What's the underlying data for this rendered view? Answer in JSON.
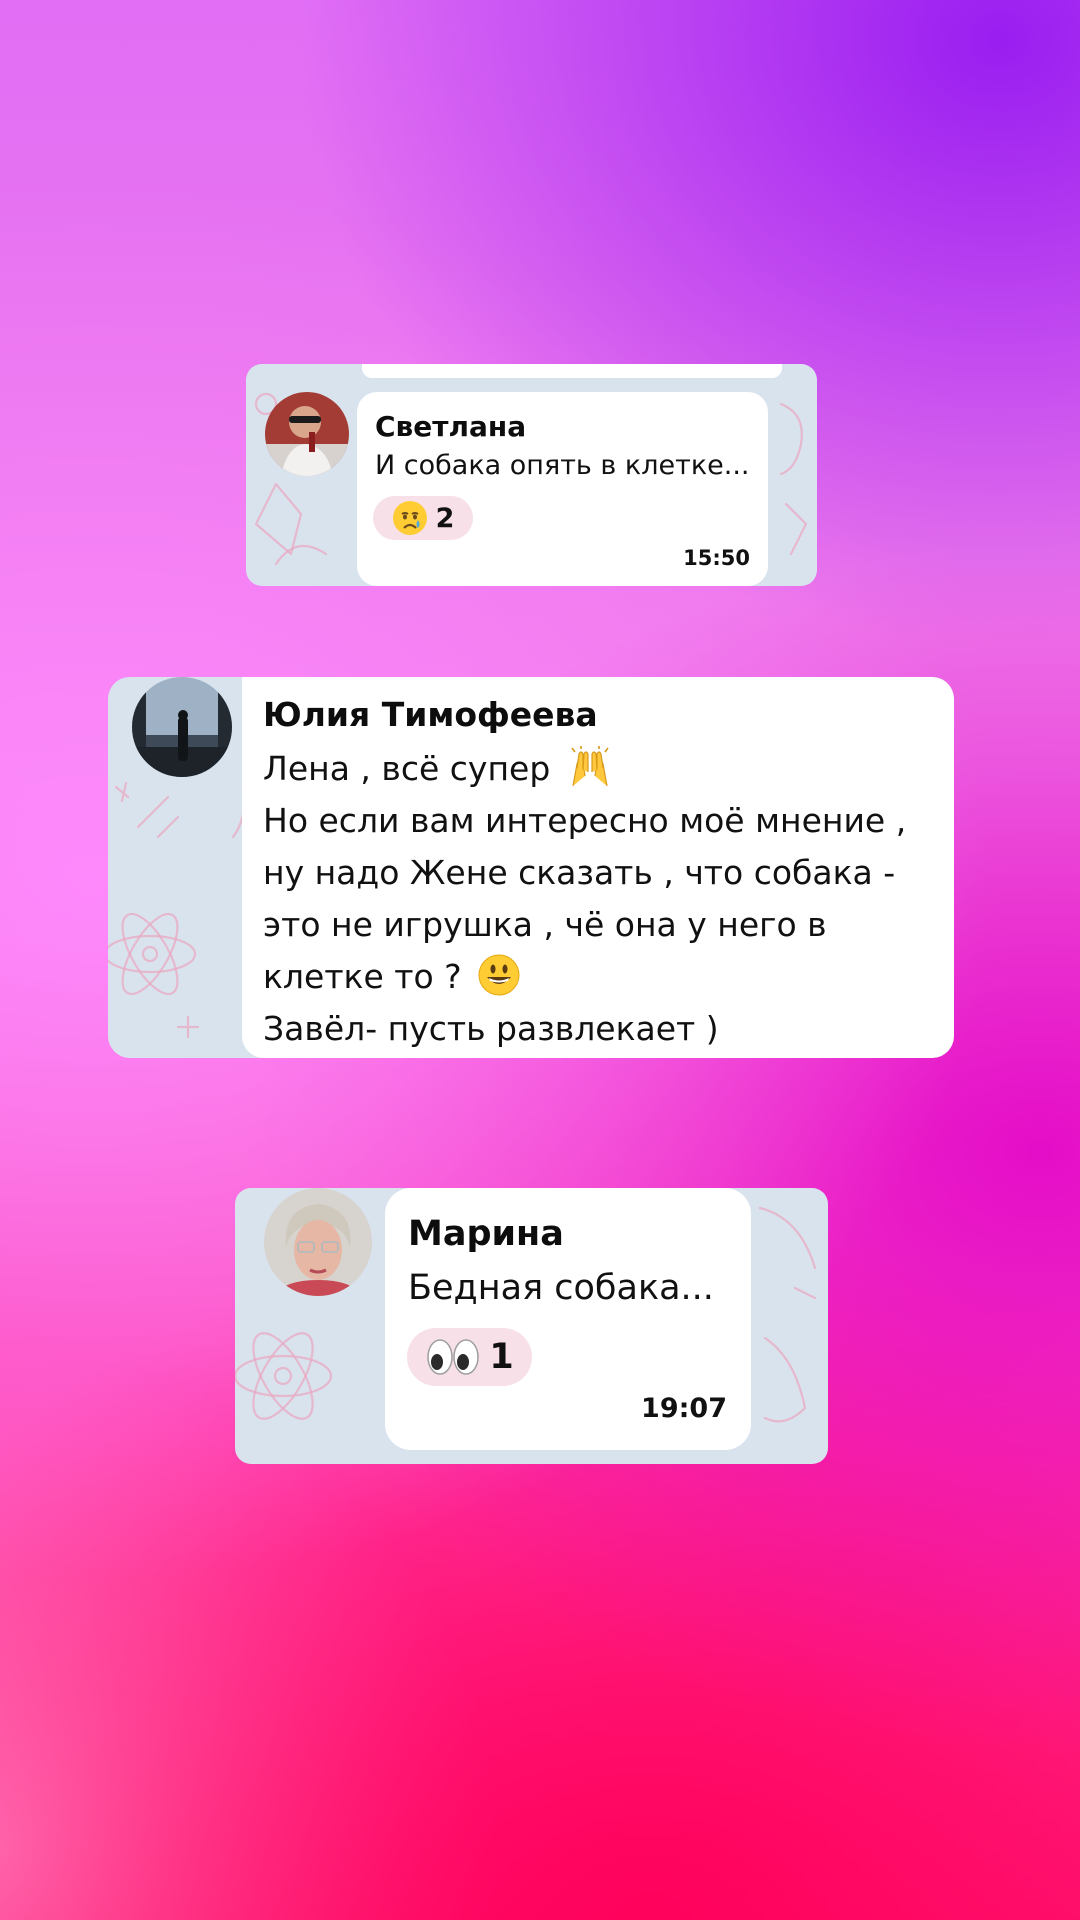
{
  "messages": [
    {
      "sender": "Светлана",
      "text": "И собака опять в клетке...",
      "reaction": {
        "emoji": "crying-face",
        "count": "2"
      },
      "time": "15:50"
    },
    {
      "sender": "Юлия Тимофеева",
      "lines": [
        "Лена , всё супер",
        "Но если вам интересно моё мнение ,",
        "ну надо Жене сказать , что собака -",
        "это не игрушка , чё она у него в",
        "клетке то ?",
        "Завёл- пусть развлекает )"
      ],
      "inline_emojis": [
        "raising-hands",
        "grinning-face"
      ]
    },
    {
      "sender": "Марина",
      "text": "Бедная собака...",
      "reaction": {
        "emoji": "eyes",
        "count": "1"
      },
      "time": "19:07"
    }
  ],
  "colors": {
    "card_background": "#d9e3ee",
    "bubble": "#ffffff",
    "reaction_pill": "#f7e0e7",
    "pattern": "#e8a9c2"
  }
}
